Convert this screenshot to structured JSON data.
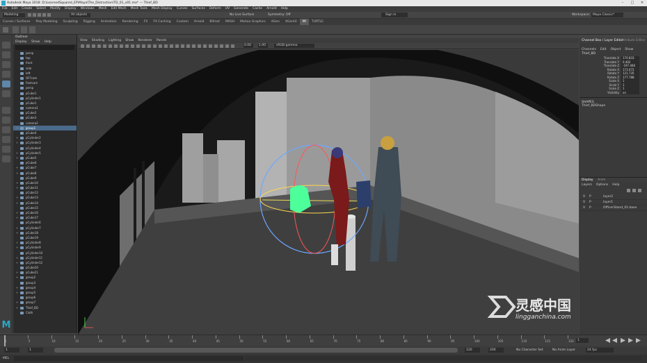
{
  "window": {
    "title": "Autodesk Maya 2018: D:\\LearnedSquared_EP\\Maya\\The_Distraction\\TD_01_v01.ma* --- Thief_BD",
    "controls": [
      "–",
      "□",
      "✕"
    ]
  },
  "menubar": [
    "File",
    "Edit",
    "Create",
    "Select",
    "Modify",
    "Display",
    "Windows",
    "Mesh",
    "Edit Mesh",
    "Mesh Tools",
    "Mesh Display",
    "Curves",
    "Surfaces",
    "Deform",
    "UV",
    "Generate",
    "Cache",
    "Arnold",
    "Help"
  ],
  "statusline": {
    "mode": "Modeling",
    "select_filter": "All objects",
    "live_surface": "No Live Surface",
    "symmetry": "Symmetry: Off",
    "sign_in": "Sign In",
    "workspace_label": "Workspace:",
    "workspace_value": "Maya Classic*"
  },
  "shelf_tabs": [
    "Curves / Surfaces",
    "Poly Modeling",
    "Sculpting",
    "Rigging",
    "Animation",
    "Rendering",
    "FX",
    "FX Caching",
    "Custom",
    "Arnold",
    "Bifrost",
    "MASH",
    "Motion Graphics",
    "XGen",
    "XGenUI",
    "MI",
    "TURTLE"
  ],
  "shelf_active": "MI",
  "outliner": {
    "title": "Outliner",
    "menu": [
      "Display",
      "Show",
      "Help"
    ],
    "items": [
      "persp",
      "top",
      "front",
      "side",
      "left",
      "OFFcam",
      "Feetcam",
      "persp",
      "pCube1",
      "pCylinder1",
      "pCube1",
      "camera1",
      "pCube2",
      "pCube3",
      "camera2",
      "group1",
      "pCube4",
      "pCylinder2",
      "pCylinder3",
      "pCylinder4",
      "pCylinder5",
      "pCube5",
      "pCube6",
      "pCube7",
      "pCube8",
      "pCube9",
      "pCube10",
      "pCube11",
      "pCube12",
      "pCube13",
      "pCube14",
      "pCube15",
      "pCube16",
      "pCube17",
      "pCylinder6",
      "pCylinder7",
      "pCube18",
      "pCube19",
      "pCylinder8",
      "pCylinder9",
      "pCylinder10",
      "pCylinder11",
      "pCylinder12",
      "pCube20",
      "pCube21",
      "group2",
      "group3",
      "group4",
      "group5",
      "group6",
      "group7",
      "Thief_BD",
      "Cloth"
    ],
    "selected_index": 15
  },
  "viewport": {
    "menu": [
      "View",
      "Shading",
      "Lighting",
      "Show",
      "Renderer",
      "Panels"
    ],
    "field1": "0.00",
    "field2": "1.00",
    "colorspace": "sRGB gamma"
  },
  "channel_box": {
    "tabs": [
      "Channel Box / Layer Editor",
      "Attribute Editor"
    ],
    "menu": [
      "Channels",
      "Edit",
      "Object",
      "Show"
    ],
    "object": "Thief_BD",
    "channels": [
      {
        "name": "Translate X",
        "value": "170.833"
      },
      {
        "name": "Translate Y",
        "value": "0.402"
      },
      {
        "name": "Translate Z",
        "value": "-197.466"
      },
      {
        "name": "Rotate X",
        "value": "173.072"
      },
      {
        "name": "Rotate Y",
        "value": "121.735"
      },
      {
        "name": "Rotate Z",
        "value": "177.788"
      },
      {
        "name": "Scale X",
        "value": "1"
      },
      {
        "name": "Scale Y",
        "value": "1"
      },
      {
        "name": "Scale Z",
        "value": "1"
      },
      {
        "name": "Visibility",
        "value": "on"
      }
    ],
    "shapes_label": "SHAPES",
    "shape_name": "Thief_BDShape"
  },
  "layer_editor": {
    "tabs": [
      "Display",
      "Anim"
    ],
    "menu": [
      "Layers",
      "Options",
      "Help"
    ],
    "layers": [
      {
        "v": "V",
        "p": "P",
        "name": "layer2"
      },
      {
        "v": "V",
        "p": "P",
        "name": "layer1"
      },
      {
        "v": "V",
        "p": "P",
        "name": "OfficerStand_01:base"
      }
    ]
  },
  "timeline": {
    "ticks": [
      "1",
      "5",
      "10",
      "15",
      "20",
      "25",
      "30",
      "35",
      "40",
      "45",
      "50",
      "55",
      "60",
      "65",
      "70",
      "75",
      "80",
      "85",
      "90",
      "95",
      "100",
      "105",
      "110",
      "115",
      "120"
    ],
    "current_frame": "1",
    "range_start": "1",
    "range_end": "120",
    "anim_end": "200",
    "anim_start": "1",
    "char_set": "No Character Set",
    "anim_layer": "No Anim Layer",
    "fps": "24 fps"
  },
  "cmdline": {
    "label": "MEL"
  },
  "watermark": {
    "brand": "灵感中国",
    "url": "lingganchina.com"
  },
  "colors": {
    "selected_row": "#4a6a8a",
    "viewport_wall": "#a9a9a9",
    "highlight_green": "#4dff9a"
  }
}
